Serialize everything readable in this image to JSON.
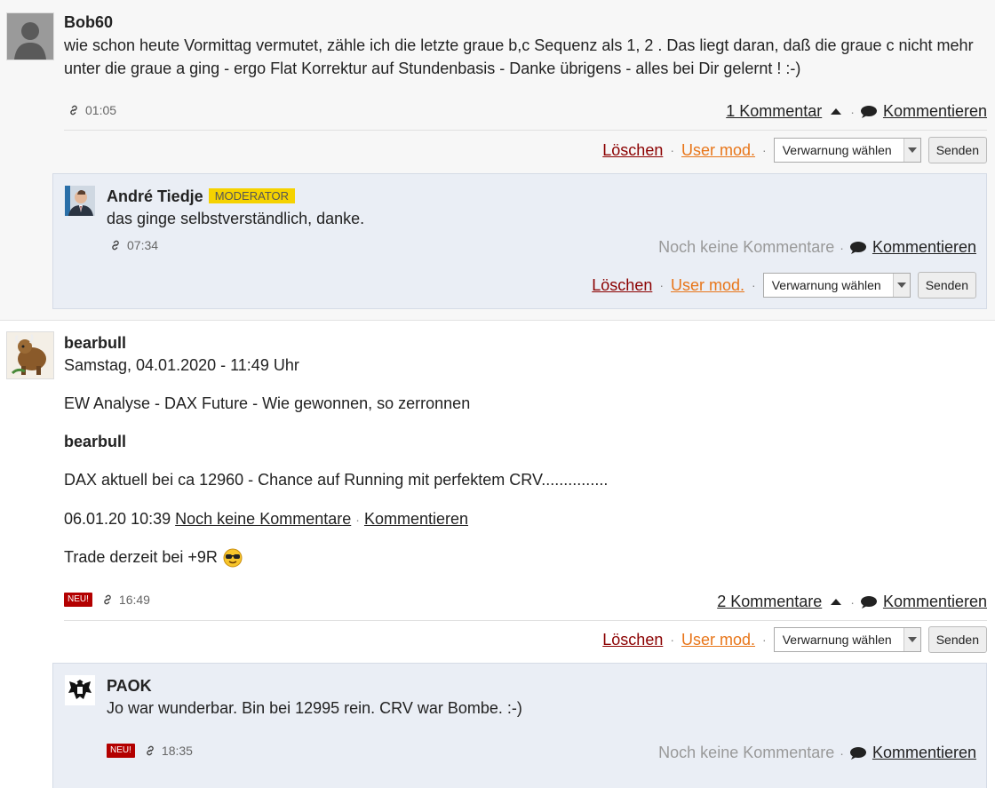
{
  "posts": [
    {
      "username": "Bob60",
      "avatar_icon": "default-user-silhouette",
      "text": "wie schon heute Vormittag vermutet, zähle ich die letzte graue b,c Sequenz als 1, 2 . Das liegt daran, daß die graue c nicht mehr",
      "text2": "unter die graue a ging - ergo Flat Korrektur auf Stundenbasis - Danke übrigens - alles bei Dir gelernt ! :-)",
      "time": "01:05",
      "comment_count": "1 Kommentar",
      "comment_action": "Kommentieren",
      "mod": {
        "delete": "Löschen",
        "user_mod": "User mod.",
        "select_value": "Verwarnung wählen",
        "send": "Senden"
      },
      "replies": [
        {
          "username": "André Tiedje",
          "badge": "MODERATOR",
          "avatar_icon": "user-photo",
          "text": "das ginge selbstverständlich, danke.",
          "time": "07:34",
          "comment_status": "Noch keine Kommentare",
          "comment_action": "Kommentieren",
          "mod": {
            "delete": "Löschen",
            "user_mod": "User mod.",
            "select_value": "Verwarnung wählen",
            "send": "Senden"
          }
        }
      ]
    },
    {
      "username": "bearbull",
      "avatar_icon": "bull-bear-image",
      "date": "Samstag, 04.01.2020 - 11:49 Uhr",
      "line1": "EW Analyse - DAX Future - Wie gewonnen, so zerronnen",
      "line2": "bearbull",
      "line3": "DAX aktuell bei ca 12960 - Chance auf Running mit perfektem CRV...............",
      "line4_date": "06.01.20 10:39",
      "line4_link1": "Noch keine Kommentare",
      "line4_sep": "·",
      "line4_link2": "Kommentieren",
      "line5": "Trade derzeit bei +9R",
      "new_badge": "NEU!",
      "time": "16:49",
      "comment_count": "2 Kommentare",
      "comment_action": "Kommentieren",
      "mod": {
        "delete": "Löschen",
        "user_mod": "User mod.",
        "select_value": "Verwarnung wählen",
        "send": "Senden"
      },
      "replies": [
        {
          "username": "PAOK",
          "avatar_icon": "paok-eagle-logo",
          "text": "Jo war wunderbar. Bin bei 12995 rein. CRV war Bombe. :-)",
          "new_badge": "NEU!",
          "time": "18:35",
          "comment_status": "Noch keine Kommentare",
          "comment_action": "Kommentieren"
        }
      ]
    }
  ],
  "separator": "·",
  "colors": {
    "delete": "#8b0000",
    "user_mod": "#e8761a",
    "reply_bg": "#eaeef5",
    "moderator_badge": "#f5d200",
    "new_badge": "#b30000"
  }
}
